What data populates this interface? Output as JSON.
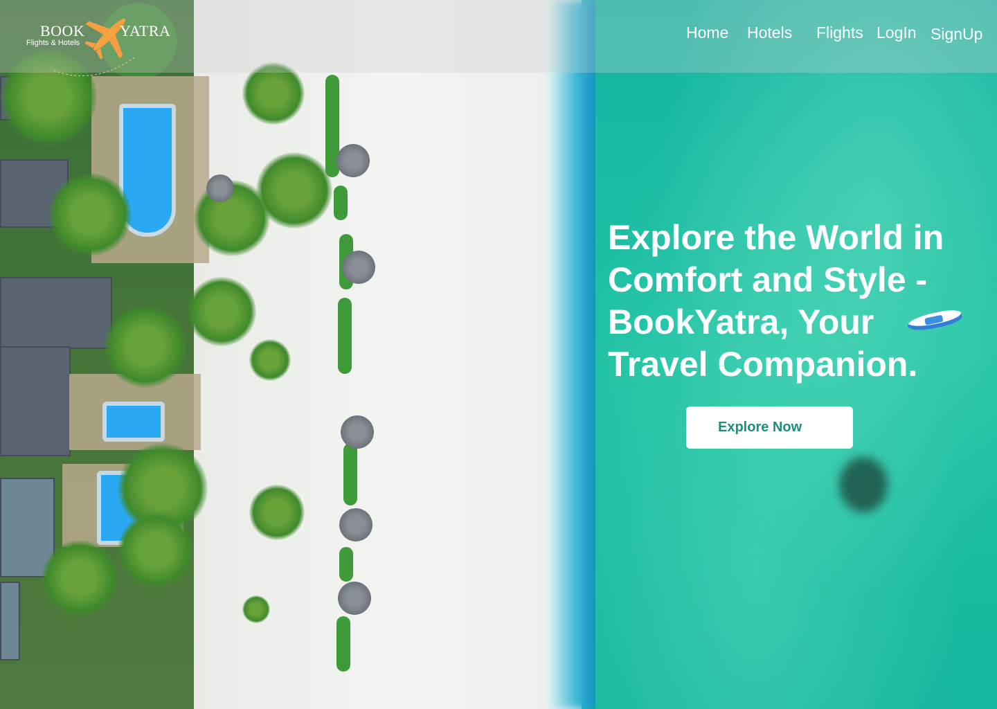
{
  "brand": {
    "name_left": "BOOK",
    "name_right": "YATRA",
    "tagline": "Flights & Hotels",
    "accent_color": "#F7A03F"
  },
  "nav": {
    "items": [
      {
        "label": "Home"
      },
      {
        "label": "Hotels"
      },
      {
        "label": "Flights"
      },
      {
        "label": "LogIn"
      },
      {
        "label": "SignUp"
      }
    ]
  },
  "hero": {
    "headline": "Explore the World in Comfort and Style - BookYatra, Your Travel Companion.",
    "cta_label": "Explore Now",
    "cta_text_color": "#1E8E7A",
    "background_icon": "aerial-beach-image"
  }
}
